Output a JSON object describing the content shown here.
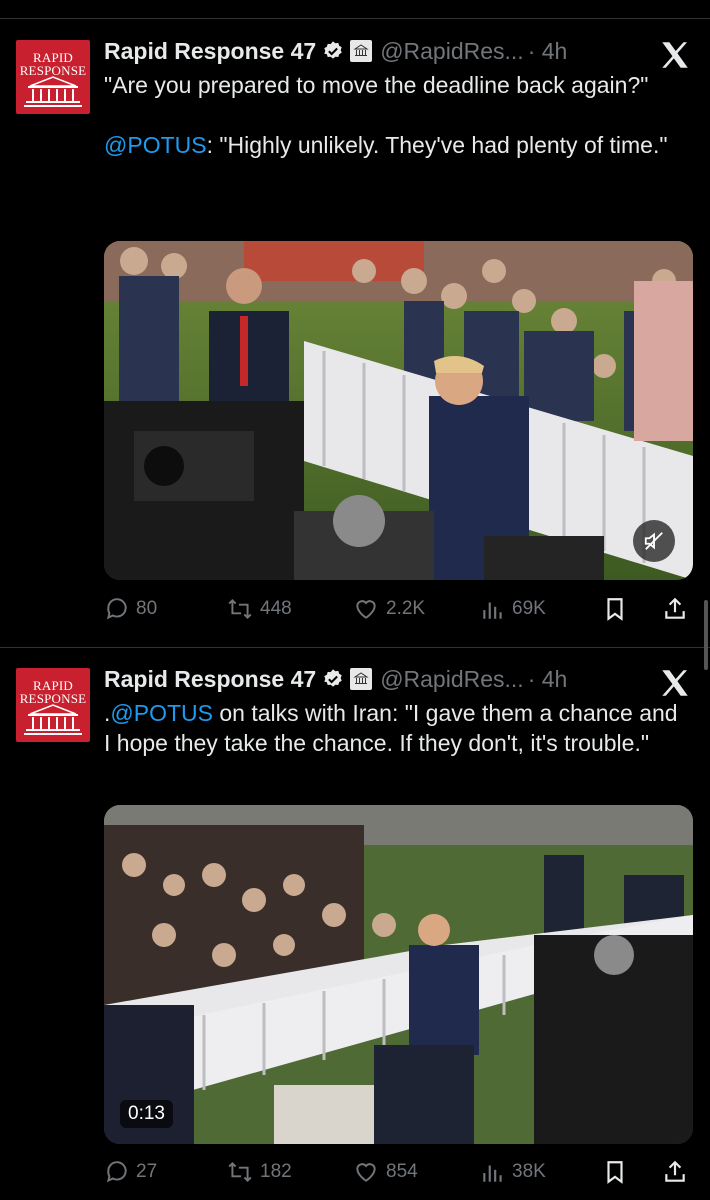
{
  "tweets": [
    {
      "display_name": "Rapid Response 47",
      "handle": "@RapidRes...",
      "time": "· 4h",
      "text_before_mention": "\"Are you prepared to move the deadline back again?\"\n\n",
      "mention": "@POTUS",
      "text_after_mention": ": \"Highly unlikely. They've had plenty of time.\"",
      "stats": {
        "replies": "80",
        "reposts": "448",
        "likes": "2.2K",
        "views": "69K"
      }
    },
    {
      "display_name": "Rapid Response 47",
      "handle": "@RapidRes...",
      "time": "· 4h",
      "text_before_mention": ".",
      "mention": "@POTUS",
      "text_after_mention": " on talks with Iran: \"I gave them a chance and I hope they take the chance. If they don't, it's trouble.\"",
      "video_time": "0:13",
      "stats": {
        "replies": "27",
        "reposts": "182",
        "likes": "854",
        "views": "38K"
      }
    }
  ],
  "avatar": {
    "line1": "RAPID",
    "line2": "RESPONSE",
    "color": "#c8202f"
  },
  "white_house_badge_text": "WHITE HOUSE",
  "colors": {
    "mention": "#1d9bf0",
    "muted": "#71767b",
    "verified": "#e7e9ea"
  },
  "icons": [
    "x-logo-icon",
    "verified-icon",
    "reply-icon",
    "repost-icon",
    "like-icon",
    "views-icon",
    "bookmark-icon",
    "share-icon",
    "mute-icon"
  ]
}
